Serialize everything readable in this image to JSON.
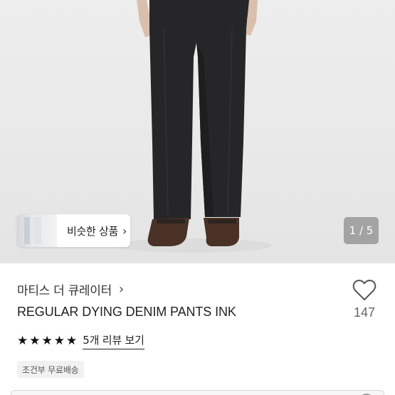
{
  "gallery": {
    "similar_products_label": "비슷한 상품",
    "similar_chevron": "›",
    "image_counter": "1 / 5"
  },
  "product": {
    "store_name": "마티스 더 큐레이터",
    "store_chevron": "›",
    "title": "REGULAR DYING DENIM PANTS INK",
    "like_count": "147",
    "rating_stars": [
      "★",
      "★",
      "★",
      "★",
      "★"
    ],
    "rating_value": 5,
    "reviews_link": "5개 리뷰 보기",
    "shipping_badge": "조건부 무료배송"
  },
  "colors": {
    "background": "#ffffff",
    "text_primary": "#222222",
    "star": "#111111",
    "counter_bg": "#6e6e6e"
  }
}
